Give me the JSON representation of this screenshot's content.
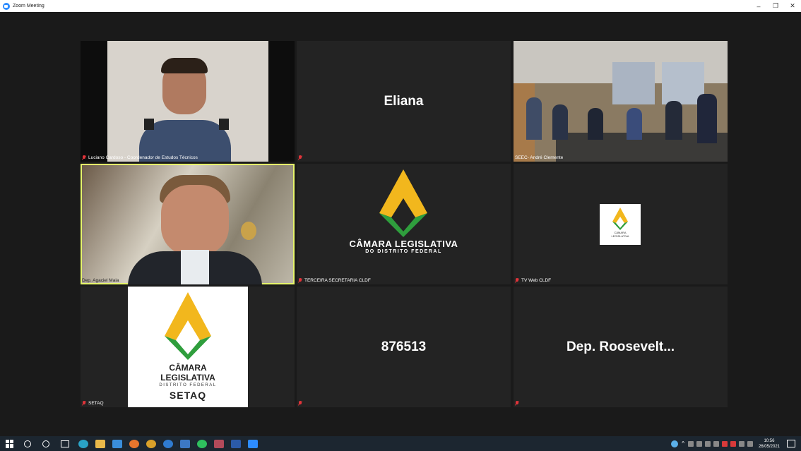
{
  "window": {
    "title": "Zoom Meeting",
    "controls": [
      "–",
      "❐",
      "✕"
    ]
  },
  "participants": [
    {
      "name": "Luciano Cardoso - Coordenador de Estudos Técnicos",
      "muted": true,
      "video": true
    },
    {
      "name": "",
      "display_name": "Eliana",
      "muted": true,
      "video": false
    },
    {
      "name": "SEEC- André Clemente",
      "muted": false,
      "video": true
    },
    {
      "name": "Dep. Agaciel Maia",
      "muted": false,
      "video": true,
      "active_speaker": true
    },
    {
      "name": "TERCEIRA SECRETARIA CLDF",
      "muted": true,
      "video": true
    },
    {
      "name": "TV Web CLDF",
      "muted": true,
      "video": true
    },
    {
      "name": "SETAQ",
      "muted": true,
      "video": true
    },
    {
      "name": "",
      "display_name": "876513",
      "muted": true,
      "video": false
    },
    {
      "name": "",
      "display_name": "Dep. Roosevelt...",
      "muted": true,
      "video": false
    }
  ],
  "logos": {
    "camara_large": {
      "line1": "CÂMARA LEGISLATIVA",
      "line2": "DO DISTRITO FEDERAL"
    },
    "camara_small": {
      "line1": "CÂMARA",
      "line2": "LEGISLATIVA"
    },
    "setaq": {
      "line1": "CÂMARA",
      "line2": "LEGISLATIVA",
      "line3": "DISTRITO FEDERAL",
      "line4": "SETAQ"
    }
  },
  "taskbar": {
    "clock_time": "10:56",
    "clock_date": "26/05/2021"
  },
  "colors": {
    "active_speaker_border": "#e6f56b",
    "muted_icon": "#e0343a",
    "logo_gold": "#f2b71d",
    "logo_green": "#2f9e3d"
  }
}
